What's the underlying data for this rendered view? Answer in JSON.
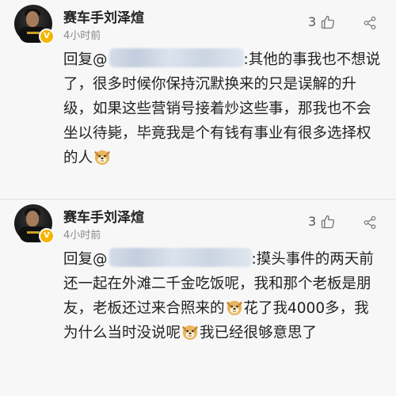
{
  "comments": [
    {
      "username": "赛车手刘泽煊",
      "time": "4小时前",
      "likes": "3",
      "reply_label": "回复@",
      "segments": [
        ":其他的事我也不想说了，很多时候你保持沉默换来的只是误解的升级，如果这些营销号接着炒这些事，那我也不会坐以待毙，毕竟我是个有钱有事业有很多选择权的人"
      ],
      "emojis": [
        "doge-emoji"
      ]
    },
    {
      "username": "赛车手刘泽煊",
      "time": "4小时前",
      "likes": "3",
      "reply_label": "回复@",
      "segments": [
        ":摸头事件的两天前还一起在外滩二千金吃饭呢，我和那个老板是朋友，老板还过来合照来的",
        "花了我4000多，我为什么当时没说呢",
        "我已经很够意思了"
      ],
      "emojis": [
        "doge-emoji",
        "doge-emoji"
      ]
    }
  ],
  "colors": {
    "background": "#f7f7f7",
    "text": "#222222",
    "meta": "#8a8a8a",
    "verified_badge": "#f5b400"
  },
  "icons": {
    "like": "thumbs-up-icon",
    "share": "share-icon",
    "verified": "verified-badge-icon"
  }
}
